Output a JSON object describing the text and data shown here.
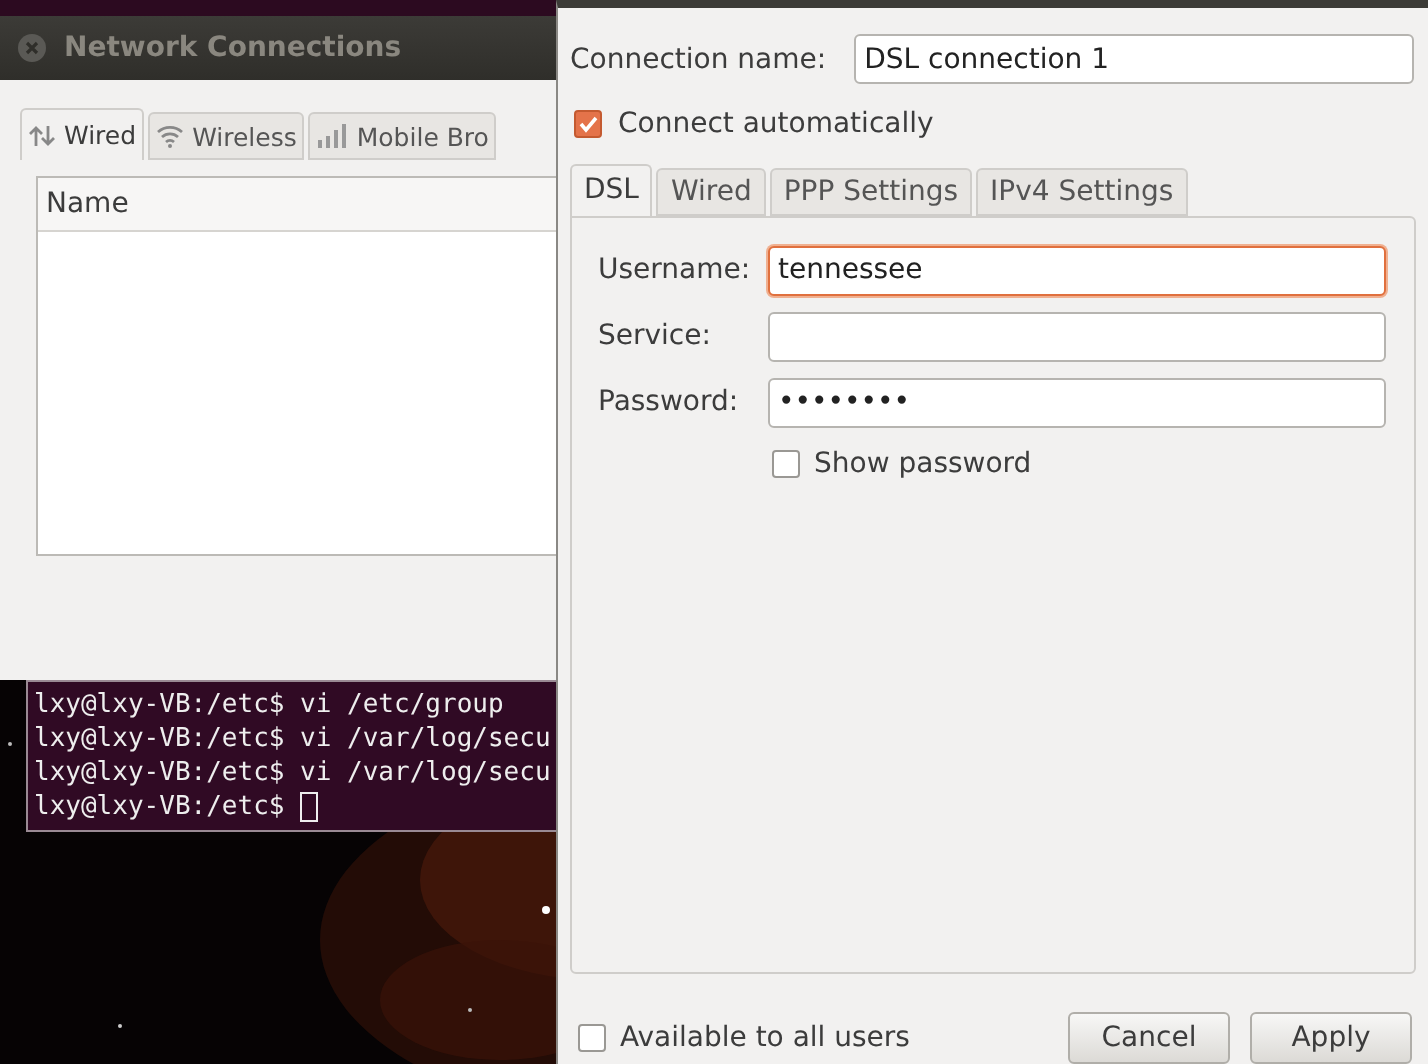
{
  "network_window": {
    "title": "Network Connections",
    "tabs": [
      {
        "label": "Wired",
        "kind": "wired",
        "selected": true
      },
      {
        "label": "Wireless",
        "kind": "wireless",
        "selected": false
      },
      {
        "label": "Mobile Bro",
        "kind": "mobile",
        "selected": false
      }
    ],
    "list": {
      "columns": [
        "Name"
      ]
    }
  },
  "terminal": {
    "lines": [
      "lxy@lxy-VB:/etc$ vi /etc/group",
      "lxy@lxy-VB:/etc$ vi /var/log/secu",
      "lxy@lxy-VB:/etc$ vi /var/log/secu",
      "lxy@lxy-VB:/etc$ "
    ]
  },
  "edit_window": {
    "connection_name": {
      "label": "Connection name:",
      "value": "DSL connection 1"
    },
    "connect_automatically": {
      "label": "Connect automatically",
      "checked": true
    },
    "tabs": [
      {
        "label": "DSL",
        "selected": true
      },
      {
        "label": "Wired",
        "selected": false
      },
      {
        "label": "PPP Settings",
        "selected": false
      },
      {
        "label": "IPv4 Settings",
        "selected": false
      }
    ],
    "fields": [
      {
        "label": "Username:",
        "value": "tennessee",
        "focused": true
      },
      {
        "label": "Service:",
        "focused": false
      },
      {
        "label": "Password:",
        "value": "••••••••",
        "focused": false
      }
    ],
    "show_password": {
      "label": "Show password",
      "checked": false
    },
    "available_to_all_users": {
      "label": "Available to all users",
      "checked": false
    },
    "buttons": [
      "Cancel",
      "Apply"
    ]
  }
}
